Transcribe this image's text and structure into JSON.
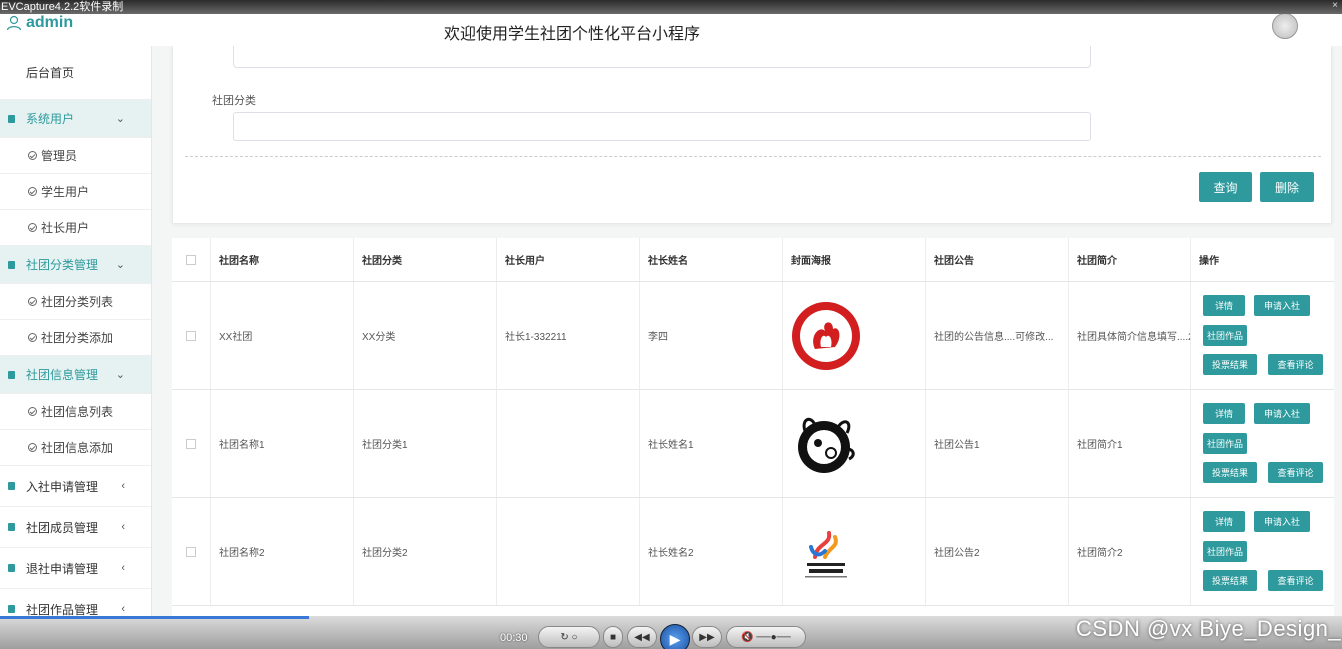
{
  "capture": {
    "title": "EVCapture4.2.2软件录制",
    "close": "×"
  },
  "header": {
    "logo_text": "admin",
    "app_title": "欢迎使用学生社团个性化平台小程序"
  },
  "sidebar": {
    "home": "后台首页",
    "groups": [
      {
        "label": "系统用户",
        "state": "open",
        "items": [
          "管理员",
          "学生用户",
          "社长用户"
        ]
      },
      {
        "label": "社团分类管理",
        "state": "open",
        "items": [
          "社团分类列表",
          "社团分类添加"
        ]
      },
      {
        "label": "社团信息管理",
        "state": "open",
        "items": [
          "社团信息列表",
          "社团信息添加"
        ]
      },
      {
        "label": "入社申请管理",
        "state": "closed"
      },
      {
        "label": "社团成员管理",
        "state": "closed"
      },
      {
        "label": "退社申请管理",
        "state": "closed"
      },
      {
        "label": "社团作品管理",
        "state": "closed"
      }
    ],
    "arrow_open": "⌄",
    "arrow_closed": "‹"
  },
  "search": {
    "category_label": "社团分类",
    "category_value": "",
    "query_button": "查询",
    "delete_button": "删除"
  },
  "table": {
    "columns": [
      "社团名称",
      "社团分类",
      "社长用户",
      "社长姓名",
      "封面海报",
      "社团公告",
      "社团简介",
      "操作"
    ],
    "rows": [
      {
        "name": "XX社团",
        "category": "XX分类",
        "leader_user": "社长1-332211",
        "leader_name": "李四",
        "poster": "poster-association-logo",
        "notice": "社团的公告信息....可修改...",
        "intro": "社团具体简介信息填写....2"
      },
      {
        "name": "社团名称1",
        "category": "社团分类1",
        "leader_user": "",
        "leader_name": "社长姓名1",
        "poster": "poster-ink-art-logo",
        "notice": "社团公告1",
        "intro": "社团简介1"
      },
      {
        "name": "社团名称2",
        "category": "社团分类2",
        "leader_user": "",
        "leader_name": "社长姓名2",
        "poster": "poster-committee-logo",
        "notice": "社团公告2",
        "intro": "社团简介2"
      }
    ],
    "actions": {
      "detail": "详情",
      "apply": "申请入社",
      "works": "社团作品",
      "vote": "投票结果",
      "comments": "查看评论"
    }
  },
  "player": {
    "time": "00:30",
    "progress": 0.23
  },
  "watermark": "CSDN @vx Biye_Design_",
  "colors": {
    "accent": "#2e9a9d",
    "sidebar_active_bg": "#e6f2f2"
  }
}
